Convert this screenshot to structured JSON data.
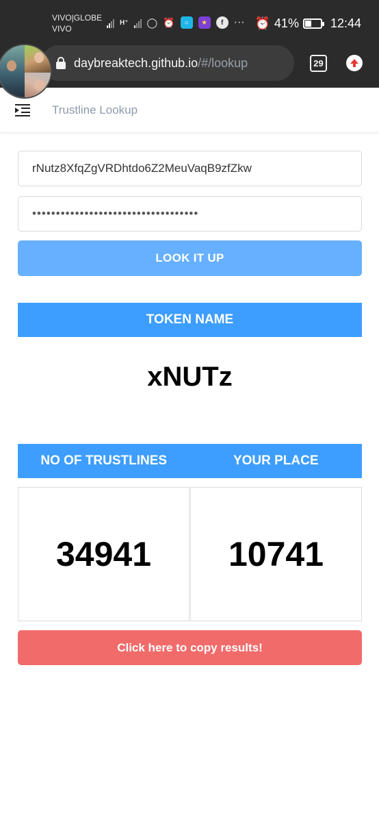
{
  "status_bar": {
    "carrier_line1": "VIVO|GLOBE",
    "carrier_line2": "VIVO",
    "network_label": "H⁺",
    "battery_percent": "41%",
    "battery_level": 0.41,
    "time": "12:44",
    "more_label": "···"
  },
  "browser": {
    "url_host": "daybreaktech.github.io",
    "url_path": "/#/lookup",
    "tab_count": "29"
  },
  "header": {
    "title": "Trustline Lookup"
  },
  "form": {
    "address_value": "rNutz8XfqZgVRDhtdo6Z2MeuVaqB9zfZkw",
    "secret_value": "•••••••••••••••••••••••••••••••••••",
    "lookup_label": "LOOK IT UP"
  },
  "token": {
    "header": "TOKEN NAME",
    "name": "xNUTz"
  },
  "stats": {
    "trustlines_header": "NO OF TRUSTLINES",
    "place_header": "YOUR PLACE",
    "trustlines_value": "34941",
    "place_value": "10741"
  },
  "copy_button": {
    "label": "Click here to copy results!"
  },
  "colors": {
    "primary": "#3d9eff",
    "lookup_button": "#66b0ff",
    "copy_button": "#f26b6b",
    "browser_chrome": "#2b2b2b"
  },
  "icons": {
    "menu": "menu-icon",
    "lock": "lock-icon",
    "upload": "upload-arrow-icon",
    "alarm": "alarm-icon",
    "battery": "battery-icon"
  }
}
